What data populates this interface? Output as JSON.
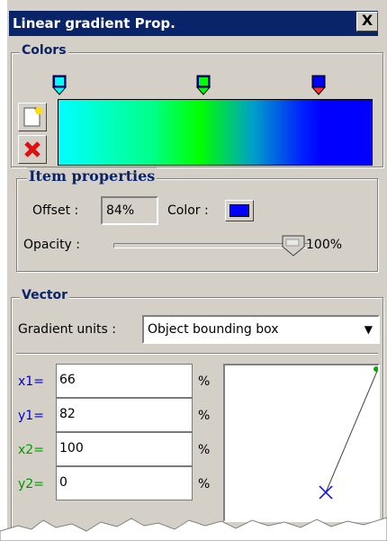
{
  "window": {
    "title": "Linear gradient Prop.",
    "close_label": "X"
  },
  "colors": {
    "legend": "Colors",
    "gradient_stops": [
      "#00ffff",
      "#00ff00",
      "#0000ff"
    ],
    "buttons": {
      "add_icon": "new-stop-icon",
      "delete_icon": "delete-stop-icon"
    }
  },
  "item_properties": {
    "legend": "Item properties",
    "offset_label": "Offset :",
    "offset_value": "84%",
    "color_label": "Color :",
    "color_value": "#0000ff",
    "opacity_label": "Opacity :",
    "opacity_value": "100%"
  },
  "vector": {
    "legend": "Vector",
    "units_label": "Gradient units :",
    "units_value": "Object bounding box",
    "fields": [
      {
        "label": "x1=",
        "value": "66",
        "unit": "%"
      },
      {
        "label": "y1=",
        "value": "82",
        "unit": "%"
      },
      {
        "label": "x2=",
        "value": "100",
        "unit": "%"
      },
      {
        "label": "y2=",
        "value": "0",
        "unit": "%"
      }
    ]
  }
}
